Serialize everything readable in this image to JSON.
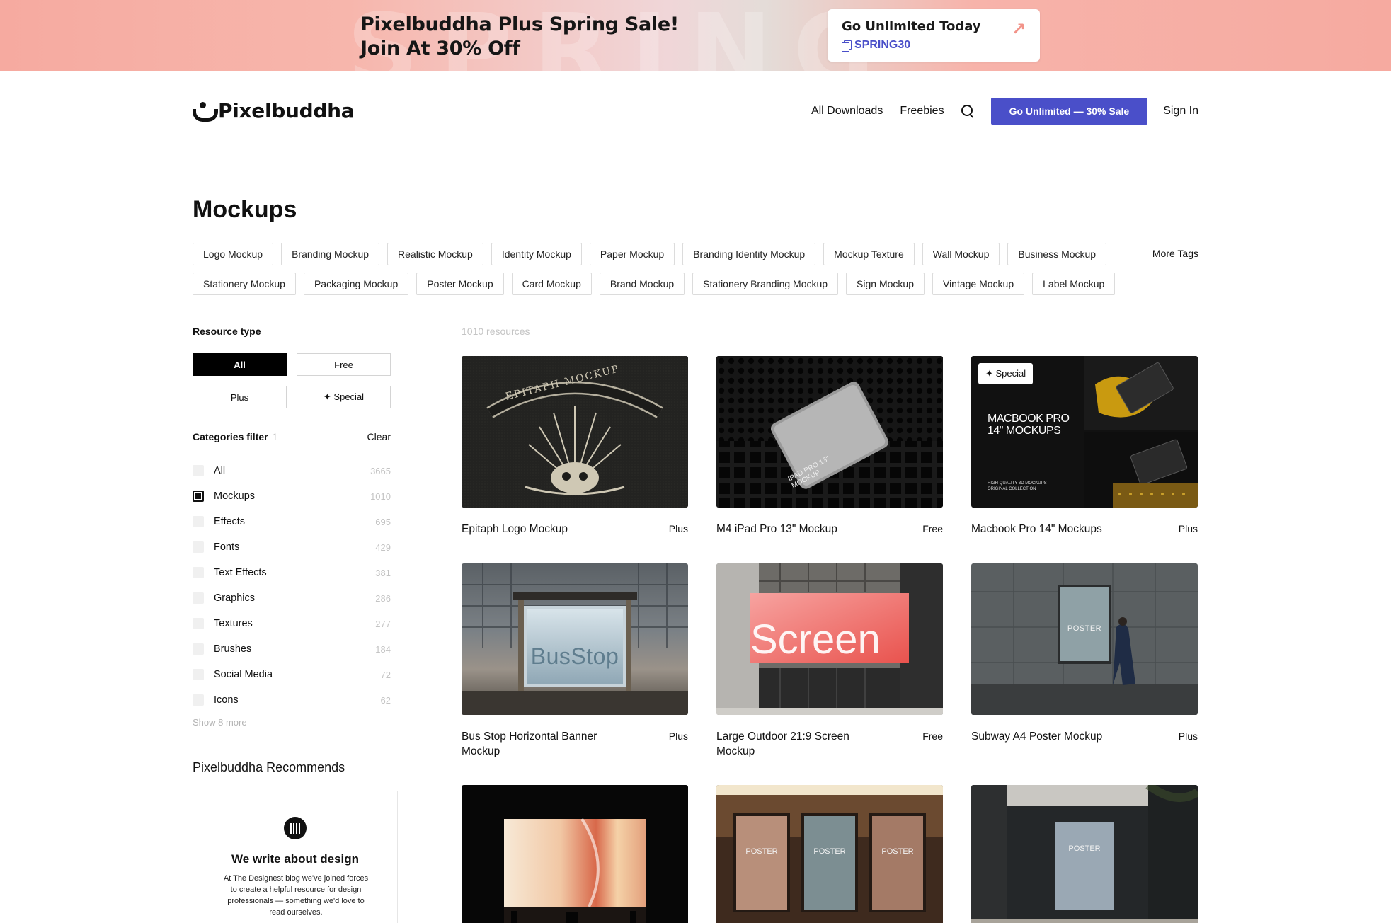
{
  "promo": {
    "ghost_text": "SPRING",
    "line1": "Pixelbuddha Plus Spring Sale!",
    "line2": "Join At 30% Off",
    "card_title": "Go Unlimited Today",
    "code": "SPRING30",
    "arrow_icon": "arrow-up-right-icon",
    "accent": "#4a4fc9",
    "background": "#f6aaa0"
  },
  "header": {
    "logo_text": "Pixelbuddha",
    "nav": {
      "downloads": "All Downloads",
      "freebies": "Freebies"
    },
    "cta": "Go Unlimited — 30% Sale",
    "signin": "Sign In"
  },
  "page": {
    "title": "Mockups",
    "more_tags": "More Tags",
    "tags": [
      "Logo Mockup",
      "Branding Mockup",
      "Realistic Mockup",
      "Identity Mockup",
      "Paper Mockup",
      "Branding Identity Mockup",
      "Mockup Texture",
      "Wall Mockup",
      "Business Mockup",
      "Stationery Mockup",
      "Packaging Mockup",
      "Poster Mockup",
      "Card Mockup",
      "Brand Mockup",
      "Stationery Branding Mockup",
      "Sign Mockup",
      "Vintage Mockup",
      "Label Mockup"
    ]
  },
  "sidebar": {
    "resource_type_label": "Resource type",
    "resource_types": [
      {
        "label": "All",
        "active": true
      },
      {
        "label": "Free",
        "active": false
      },
      {
        "label": "Plus",
        "active": false
      },
      {
        "label": "✦ Special",
        "active": false
      }
    ],
    "categories_label": "Categories filter",
    "categories_selected": "1",
    "clear": "Clear",
    "categories": [
      {
        "name": "All",
        "count": "3665",
        "checked": false
      },
      {
        "name": "Mockups",
        "count": "1010",
        "checked": true
      },
      {
        "name": "Effects",
        "count": "695",
        "checked": false
      },
      {
        "name": "Fonts",
        "count": "429",
        "checked": false
      },
      {
        "name": "Text Effects",
        "count": "381",
        "checked": false
      },
      {
        "name": "Graphics",
        "count": "286",
        "checked": false
      },
      {
        "name": "Textures",
        "count": "277",
        "checked": false
      },
      {
        "name": "Brushes",
        "count": "184",
        "checked": false
      },
      {
        "name": "Social Media",
        "count": "72",
        "checked": false
      },
      {
        "name": "Icons",
        "count": "62",
        "checked": false
      }
    ],
    "show_more": "Show 8 more",
    "recommends_title": "Pixelbuddha Recommends",
    "rec_heading": "We write about design",
    "rec_body": "At The Designest blog we've joined forces to create a helpful resource for design professionals — something we'd love to read ourselves."
  },
  "grid": {
    "count_label": "1010 resources",
    "items": [
      {
        "title": "Epitaph Logo Mockup",
        "badge": "Plus",
        "thumb_text": "EPITAPH MOCKUP"
      },
      {
        "title": "M4 iPad Pro 13\" Mockup",
        "badge": "Free",
        "thumb_text": "IPAD PRO 13\" MOCKUP"
      },
      {
        "title": "Macbook Pro 14\" Mockups",
        "badge": "Plus",
        "special": "✦ Special",
        "thumb_text": "MACBOOK PRO 14\" MOCKUPS",
        "thumb_subtext": "HIGH QUALITY 3D MOCKUPS ORIGINAL COLLECTION"
      },
      {
        "title": "Bus Stop Horizontal Banner Mockup",
        "badge": "Plus",
        "thumb_text": "BusStop"
      },
      {
        "title": "Large Outdoor 21:9 Screen Mockup",
        "badge": "Free",
        "thumb_text": "Screen"
      },
      {
        "title": "Subway A4 Poster Mockup",
        "badge": "Plus",
        "thumb_text": "POSTER"
      },
      {
        "title": "",
        "badge": "",
        "thumb_text": ""
      },
      {
        "title": "",
        "badge": "",
        "thumb_text": "POSTER"
      },
      {
        "title": "",
        "badge": "",
        "thumb_text": "POSTER"
      }
    ]
  }
}
